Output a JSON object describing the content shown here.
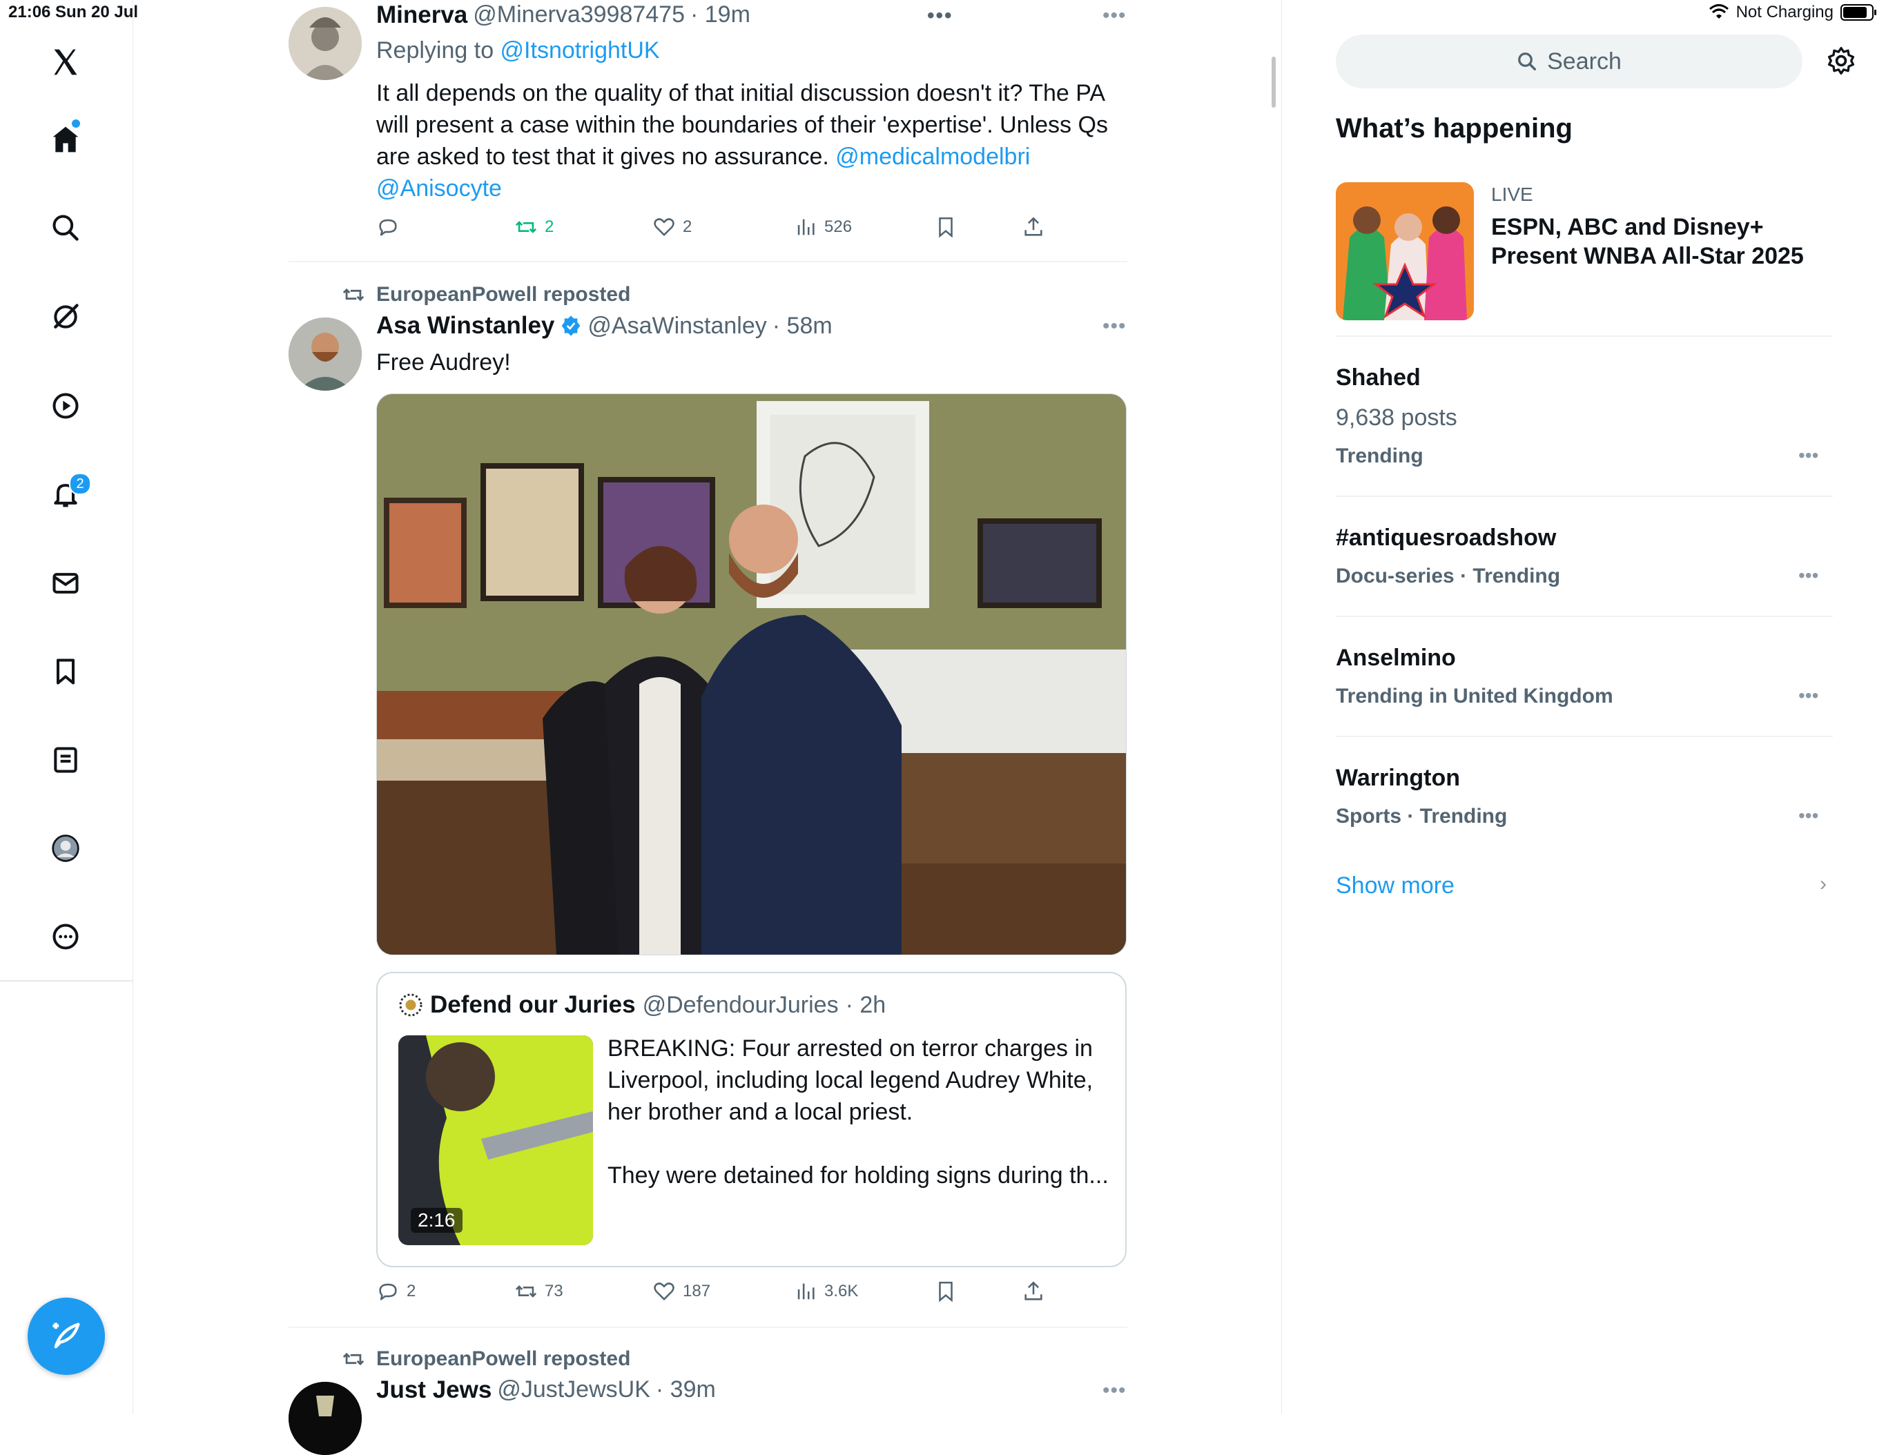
{
  "status_bar": {
    "time_date": "21:06  Sun 20 Jul",
    "charging": "Not Charging",
    "battery_level": 0.9
  },
  "nav": {
    "items": [
      "x-logo",
      "home",
      "explore",
      "grok",
      "videos",
      "notifications",
      "messages",
      "bookmarks",
      "lists",
      "profile",
      "more"
    ],
    "notification_count": "2"
  },
  "tweets": [
    {
      "name": "Minerva",
      "handle": "@Minerva39987475",
      "time": "· 19m",
      "replying_label": "Replying to ",
      "replying_to": "@ItsnotrightUK",
      "text_l1": "It all depends on the quality of that initial discussion doesn't it? The PA",
      "text_l2": "will present a case within the boundaries of their 'expertise'. Unless Qs",
      "text_l3": "are asked to test that it gives no assurance. ",
      "mention1": "@medicalmodelbri",
      "mention2": "@Anisocyte",
      "reposts": "2",
      "likes": "2",
      "views": "526"
    },
    {
      "repost_label": "EuropeanPowell reposted",
      "name": "Asa Winstanley",
      "handle": "@AsaWinstanley",
      "time": "· 58m",
      "text": "Free Audrey!",
      "quote": {
        "name": "Defend our Juries",
        "handle": "@DefendourJuries",
        "time": "· 2h",
        "line1": "BREAKING: Four arrested on terror charges in",
        "line2": "Liverpool, including local legend Audrey White,",
        "line3": "her brother and a local priest.",
        "line4": "They were detained for holding signs during th...",
        "duration": "2:16"
      },
      "replies": "2",
      "reposts": "73",
      "likes": "187",
      "views": "3.6K"
    },
    {
      "repost_label": "EuropeanPowell reposted",
      "name": "Just Jews",
      "handle": "@JustJewsUK",
      "time": "· 39m"
    }
  ],
  "sidebar": {
    "search_placeholder": "Search",
    "heading": "What’s happening",
    "live": {
      "label": "LIVE",
      "title_l1": "ESPN, ABC and Disney+",
      "title_l2": "Present WNBA All-Star 2025"
    },
    "trends": [
      {
        "title": "Shahed",
        "posts": "9,638 posts",
        "sub": "Trending"
      },
      {
        "title": "#antiquesroadshow",
        "sub": "Docu-series · Trending"
      },
      {
        "title": "Anselmino",
        "sub": "Trending in United Kingdom"
      },
      {
        "title": "Warrington",
        "sub": "Sports · Trending"
      }
    ],
    "show_more": "Show more"
  },
  "colors": {
    "accent": "#1d9bf0",
    "repost_green": "#00ba7c",
    "muted": "#536471"
  }
}
